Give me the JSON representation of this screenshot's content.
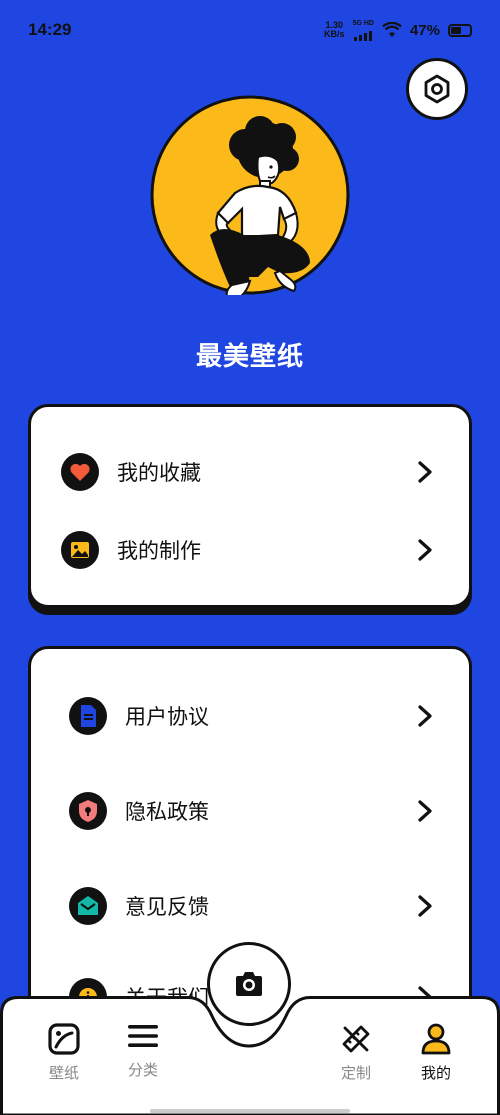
{
  "status_bar": {
    "time": "14:29",
    "net_speed_value": "1.30",
    "net_speed_unit": "KB/s",
    "network": "5G HD",
    "battery": "47%"
  },
  "profile": {
    "app_name": "最美壁纸"
  },
  "menu_primary": [
    {
      "label": "我的收藏",
      "icon": "heart-icon"
    },
    {
      "label": "我的制作",
      "icon": "image-icon"
    }
  ],
  "menu_secondary": [
    {
      "label": "用户协议",
      "icon": "document-icon"
    },
    {
      "label": "隐私政策",
      "icon": "shield-lock-icon"
    },
    {
      "label": "意见反馈",
      "icon": "mail-icon"
    },
    {
      "label": "关于我们",
      "icon": "info-icon"
    }
  ],
  "bottom_nav": {
    "items": [
      {
        "label": "壁纸",
        "icon": "wallpaper-icon"
      },
      {
        "label": "分类",
        "icon": "menu-icon"
      },
      {
        "label": "定制",
        "icon": "pencil-ruler-icon"
      },
      {
        "label": "我的",
        "icon": "user-icon"
      }
    ],
    "active": "我的",
    "center": "camera-icon"
  },
  "colors": {
    "background": "#1f46e0",
    "accent_yellow": "#fbb91a",
    "heart_red": "#f25a3a",
    "mail_teal": "#14b8a6",
    "shield_pink": "#f47b7b"
  }
}
